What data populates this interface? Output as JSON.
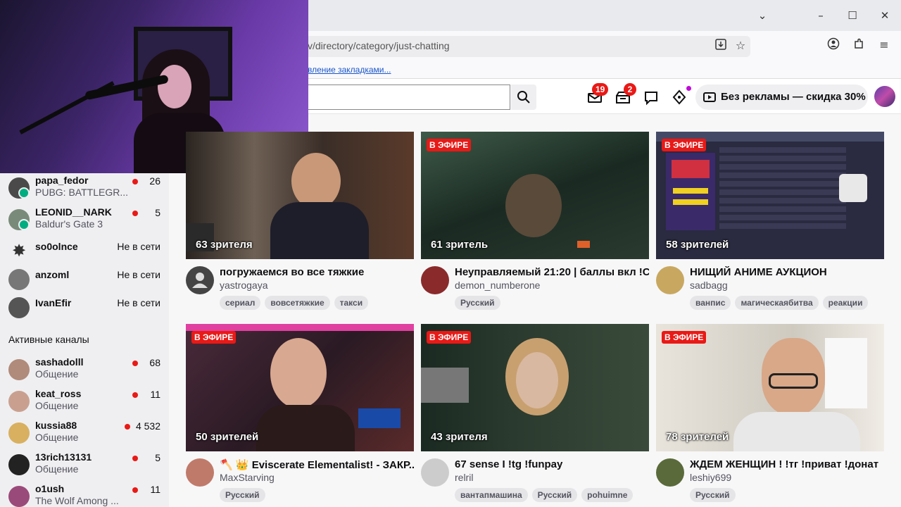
{
  "browser": {
    "url": "v/directory/category/just-chatting",
    "bookmarks_link": "вление закладками..."
  },
  "header": {
    "notifications_badge": "19",
    "inbox_badge": "2",
    "promo_text": "Без рекламы — скидка 30%"
  },
  "sidebar": {
    "followed": [
      {
        "name": "papa_fedor",
        "game": "PUBG: BATTLEGR...",
        "viewers": "26",
        "live": true,
        "avatar_color": "#4a4a4a"
      },
      {
        "name": "LEONID__NARK",
        "game": "Baldur's Gate 3",
        "viewers": "5",
        "live": true,
        "avatar_color": "#7a8a7a"
      },
      {
        "name": "so0olnce",
        "status": "Не в сети",
        "live": false,
        "avatar_color": "#333333"
      },
      {
        "name": "anzoml",
        "status": "Не в сети",
        "live": false,
        "avatar_color": "#777777"
      },
      {
        "name": "IvanEfir",
        "status": "Не в сети",
        "live": false,
        "avatar_color": "#555555"
      }
    ],
    "active_section_title": "Активные каналы",
    "active": [
      {
        "name": "sashadolll",
        "game": "Общение",
        "viewers": "68",
        "avatar_color": "#b08a7a"
      },
      {
        "name": "keat_ross",
        "game": "Общение",
        "viewers": "11",
        "avatar_color": "#c9a090"
      },
      {
        "name": "kussia88",
        "game": "Общение",
        "viewers": "4 532",
        "avatar_color": "#d8b060"
      },
      {
        "name": "13rich13131",
        "game": "Общение",
        "viewers": "5",
        "avatar_color": "#222222"
      },
      {
        "name": "o1ush",
        "game": "The Wolf Among ...",
        "viewers": "11",
        "avatar_color": "#9a4a7a"
      }
    ]
  },
  "cards": [
    {
      "live_label": "",
      "viewers": "63 зрителя",
      "title": "погружаемся во все тяжкие",
      "streamer": "yastrogaya",
      "tags": [
        "сериал",
        "вовсетяжкие",
        "такси"
      ],
      "thumb_color": "#3a2a22",
      "avatar_color": "#444444"
    },
    {
      "live_label": "В ЭФИРЕ",
      "viewers": "61 зритель",
      "title": "Неуправляемый 21:20 | баллы вкл !С...",
      "streamer": "demon_numberone",
      "tags": [
        "Русский"
      ],
      "thumb_color": "#2d3a30",
      "avatar_color": "#8a2a2a"
    },
    {
      "live_label": "В ЭФИРЕ",
      "viewers": "58 зрителей",
      "title": "НИЩИЙ АНИМЕ АУКЦИОН",
      "streamer": "sadbagg",
      "tags": [
        "ванпис",
        "магическаябитва",
        "реакции"
      ],
      "thumb_color": "#2a2a40",
      "avatar_color": "#c8a860"
    },
    {
      "live_label": "В ЭФИРЕ",
      "viewers": "50 зрителей",
      "title": "🪓 👑 Eviscerate Elementalist! - ЗАКР...",
      "streamer": "MaxStarving",
      "tags": [
        "Русский"
      ],
      "thumb_color": "#3a2030",
      "avatar_color": "#c07a6a"
    },
    {
      "live_label": "В ЭФИРЕ",
      "viewers": "43 зрителя",
      "title": "67 sense I !tg !funpay",
      "streamer": "relril",
      "tags": [
        "вантапмашина",
        "Русский",
        "pohuimne"
      ],
      "thumb_color": "#1f2a22",
      "avatar_color": "#cccccc"
    },
    {
      "live_label": "В ЭФИРЕ",
      "viewers": "78 зрителей",
      "title": "ЖДЕМ ЖЕНЩИН ! !тг !приват !донат",
      "streamer": "leshiy699",
      "tags": [
        "Русский"
      ],
      "thumb_color": "#d8d4cc",
      "avatar_color": "#5a6a3a"
    }
  ],
  "colors": {
    "live_red": "#e91916",
    "accent_purple": "#9147ff"
  }
}
